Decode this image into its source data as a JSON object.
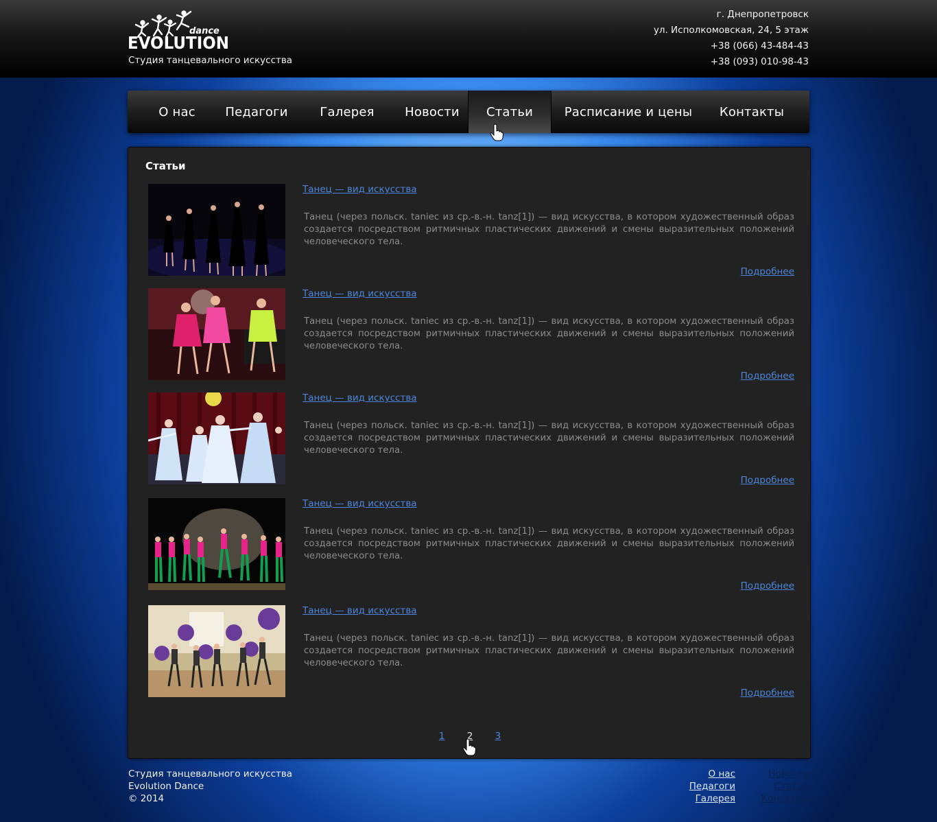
{
  "header": {
    "logo_small": "dance",
    "logo_big": "EVOLUTION",
    "slogan": "Студия танцевального искусства",
    "contacts": [
      "г. Днепропетровск",
      "ул. Исполкомовская, 24, 5 этаж",
      "+38 (066) 43-484-43",
      "+38 (093) 010-98-43"
    ]
  },
  "nav": [
    {
      "label": "О нас",
      "active": false
    },
    {
      "label": "Педагоги",
      "active": false
    },
    {
      "label": "Галерея",
      "active": false
    },
    {
      "label": "Новости",
      "active": false
    },
    {
      "label": "Статьи",
      "active": true
    },
    {
      "label": "Расписание и цены",
      "active": false
    },
    {
      "label": "Контакты",
      "active": false
    }
  ],
  "main": {
    "title": "Статьи",
    "articles": [
      {
        "title": "Танец — вид искусства",
        "text": "Танец (через польск. taniec из ср.-в.-н. tanz[1]) — вид искусства, в котором художественный образ создается посредством ритмичных пластических движений и смены выразительных положений человеческого тела.",
        "more": "Подробнее",
        "image": "dancers-black-dresses-photo"
      },
      {
        "title": "Танец — вид искусства",
        "text": "Танец (через польск. taniec из ср.-в.-н. tanz[1]) — вид искусства, в котором художественный образ создается посредством ритмичных пластических движений и смены выразительных положений человеческого тела.",
        "more": "Подробнее",
        "image": "dancers-pink-dresses-photo"
      },
      {
        "title": "Танец — вид искусства",
        "text": "Танец (через польск. taniec из ср.-в.-н. tanz[1]) — вид искусства, в котором художественный образ создается посредством ритмичных пластических движений и смены выразительных положений человеческого тела.",
        "more": "Подробнее",
        "image": "girls-white-dresses-stage-photo"
      },
      {
        "title": "Танец — вид искусства",
        "text": "Танец (через польск. taniec из ср.-в.-н. tanz[1]) — вид искусства, в котором художественный образ создается посредством ритмичных пластических движений и смены выразительных положений человеческого тела.",
        "more": "Подробнее",
        "image": "girls-pink-green-costumes-photo"
      },
      {
        "title": "Танец — вид искусства",
        "text": "Танец (через польск. taniec из ср.-в.-н. tanz[1]) — вид искусства, в котором художественный образ создается посредством ритмичных пластических движений и смены выразительных положений человеческого тела.",
        "more": "Подробнее",
        "image": "fitball-class-photo"
      }
    ],
    "pagination": [
      "1",
      "2",
      "3"
    ],
    "current_page": "2"
  },
  "footer": {
    "left": [
      "Студия танцевального искусства",
      "Evolution Dance",
      "© 2014"
    ],
    "links_col1": [
      "О нас",
      "Педагоги",
      "Галерея"
    ],
    "links_col2": [
      "Новости",
      "Статьи",
      "Контакты"
    ]
  },
  "colors": {
    "link": "#4d86de",
    "panel": "#222222",
    "accent_glow": "#9fd6ff"
  }
}
